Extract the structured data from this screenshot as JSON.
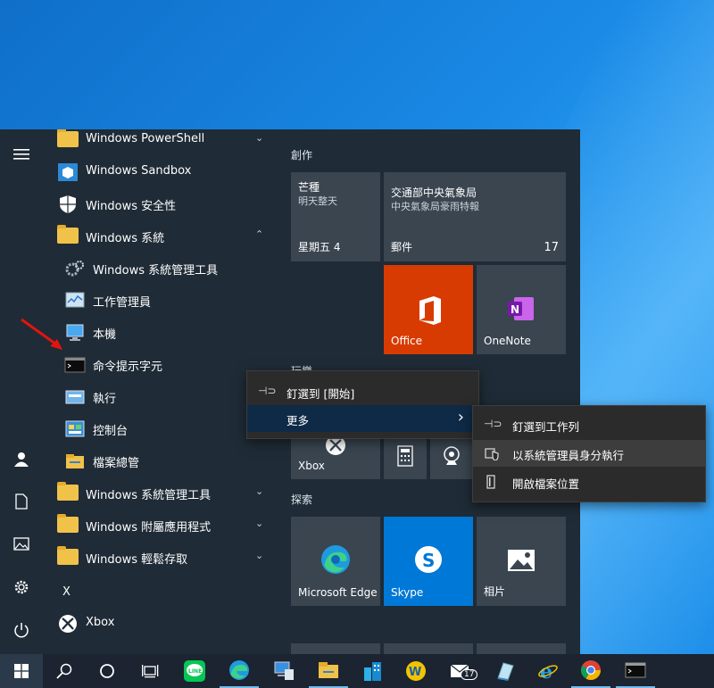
{
  "apps": [
    {
      "label": "Windows PowerShell",
      "chevron": "⌄"
    },
    {
      "label": "Windows Sandbox"
    },
    {
      "label": "Windows 安全性"
    },
    {
      "label": "Windows 系統",
      "chevron": "⌃"
    },
    {
      "label": "Windows 系統管理工具"
    },
    {
      "label": "工作管理員"
    },
    {
      "label": "本機"
    },
    {
      "label": "命令提示字元"
    },
    {
      "label": "執行"
    },
    {
      "label": "控制台"
    },
    {
      "label": "檔案總管"
    },
    {
      "label": "Windows 系統管理工具",
      "chevron": "⌄"
    },
    {
      "label": "Windows 附屬應用程式",
      "chevron": "⌄"
    },
    {
      "label": "Windows 輕鬆存取",
      "chevron": "⌄"
    },
    {
      "label": "X"
    },
    {
      "label": "Xbox"
    }
  ],
  "tiles": {
    "group_create": "創作",
    "group_partial": "玩樂",
    "group_explore": "探索",
    "weather": {
      "title": "芒種",
      "sub": "明天整天",
      "day": "星期五 4"
    },
    "mail": {
      "title": "交通部中央氣象局",
      "sub": "中央氣象局豪雨特報",
      "label": "郵件",
      "count": "17"
    },
    "office": "Office",
    "onenote": "OneNote",
    "xbox": "Xbox",
    "edge": "Microsoft Edge",
    "skype": "Skype",
    "photos": "相片"
  },
  "context_menu": {
    "pin_start": "釘選到 [開始]",
    "more": "更多",
    "more_chevron": "›"
  },
  "submenu": {
    "pin_taskbar": "釘選到工作列",
    "run_admin": "以系統管理員身分執行",
    "open_location": "開啟檔案位置"
  },
  "taskbar": {
    "mail_badge": "17"
  },
  "colors": {
    "start_bg": "#1f2b36",
    "tile": "#3a4550",
    "office": "#d83b01",
    "skype": "#0078d7",
    "accent": "#0e2a47"
  }
}
